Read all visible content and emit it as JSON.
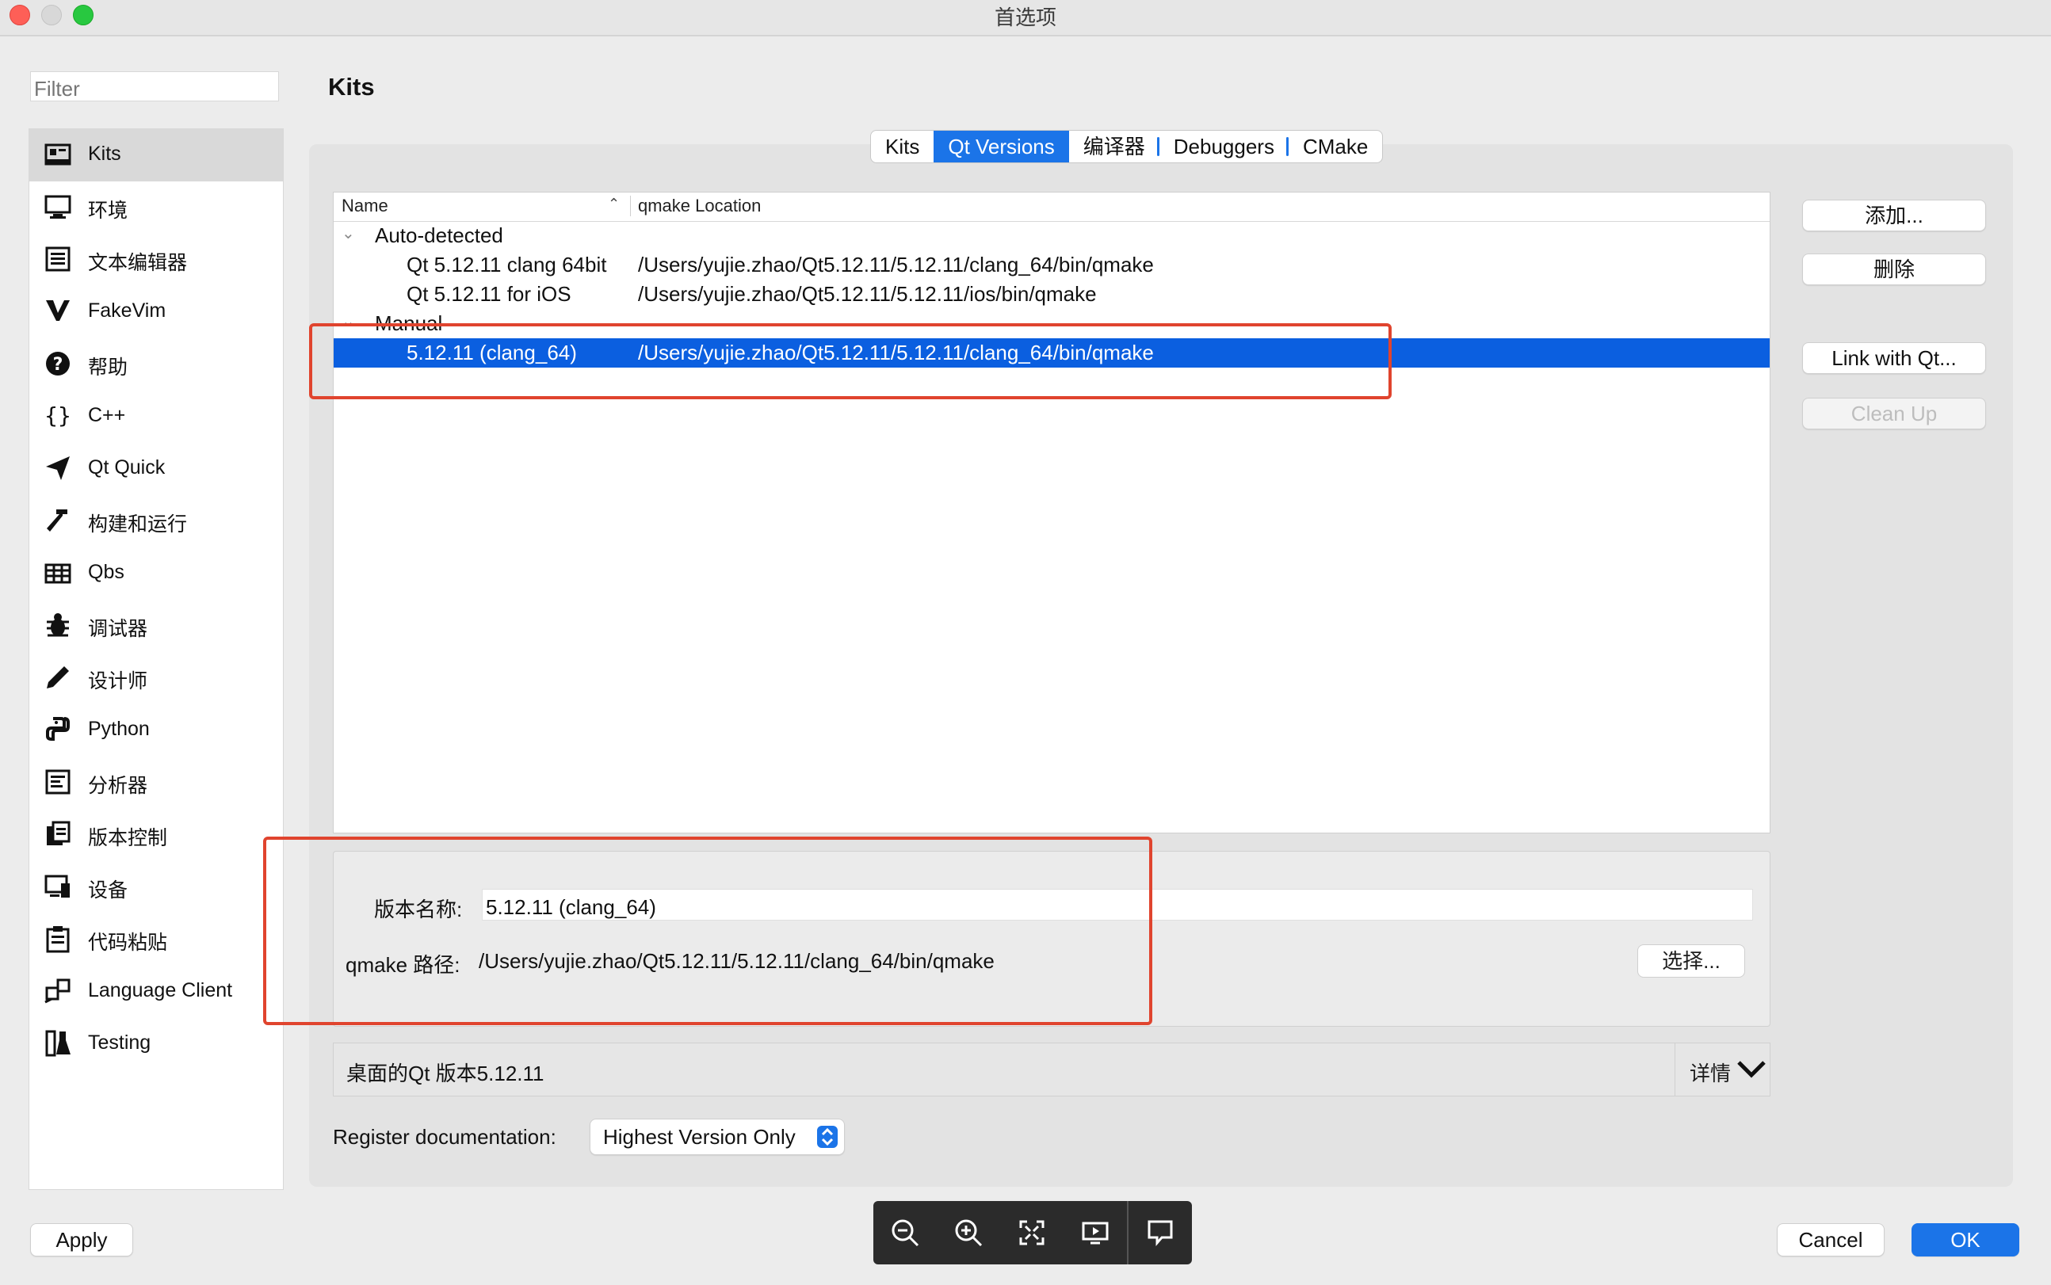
{
  "window": {
    "title": "首选项"
  },
  "sidebar": {
    "filter_placeholder": "Filter",
    "items": [
      {
        "label": "Kits",
        "icon": "kits-icon",
        "selected": true
      },
      {
        "label": "环境",
        "icon": "environment-icon"
      },
      {
        "label": "文本编辑器",
        "icon": "text-editor-icon"
      },
      {
        "label": "FakeVim",
        "icon": "fakevim-icon"
      },
      {
        "label": "帮助",
        "icon": "help-icon"
      },
      {
        "label": "C++",
        "icon": "braces-icon"
      },
      {
        "label": "Qt Quick",
        "icon": "qt-quick-icon"
      },
      {
        "label": "构建和运行",
        "icon": "hammer-icon"
      },
      {
        "label": "Qbs",
        "icon": "qbs-icon"
      },
      {
        "label": "调试器",
        "icon": "bug-icon"
      },
      {
        "label": "设计师",
        "icon": "pencil-icon"
      },
      {
        "label": "Python",
        "icon": "python-icon"
      },
      {
        "label": "分析器",
        "icon": "analyzer-icon"
      },
      {
        "label": "版本控制",
        "icon": "version-control-icon"
      },
      {
        "label": "设备",
        "icon": "device-icon"
      },
      {
        "label": "代码粘贴",
        "icon": "clipboard-icon"
      },
      {
        "label": "Language Client",
        "icon": "language-client-icon"
      },
      {
        "label": "Testing",
        "icon": "testing-icon"
      }
    ]
  },
  "main": {
    "title": "Kits",
    "tabs": [
      {
        "label": "Kits"
      },
      {
        "label": "Qt Versions",
        "selected": true
      },
      {
        "label": "编译器"
      },
      {
        "label": "Debuggers"
      },
      {
        "label": "CMake"
      }
    ],
    "tree": {
      "columns": [
        "Name",
        "qmake Location"
      ],
      "groups": [
        {
          "label": "Auto-detected",
          "rows": [
            {
              "name": "Qt 5.12.11 clang 64bit",
              "location": "/Users/yujie.zhao/Qt5.12.11/5.12.11/clang_64/bin/qmake"
            },
            {
              "name": "Qt 5.12.11 for iOS",
              "location": "/Users/yujie.zhao/Qt5.12.11/5.12.11/ios/bin/qmake"
            }
          ]
        },
        {
          "label": "Manual",
          "rows": [
            {
              "name": "5.12.11 (clang_64)",
              "location": "/Users/yujie.zhao/Qt5.12.11/5.12.11/clang_64/bin/qmake",
              "selected": true
            }
          ]
        }
      ]
    },
    "right_buttons": {
      "add": "添加...",
      "remove": "删除",
      "link": "Link with Qt...",
      "cleanup": "Clean Up"
    },
    "detail": {
      "version_name_label": "版本名称:",
      "version_name_value": "5.12.11 (clang_64)",
      "qmake_path_label": "qmake 路径:",
      "qmake_path_value": "/Users/yujie.zhao/Qt5.12.11/5.12.11/clang_64/bin/qmake",
      "choose_button": "选择..."
    },
    "info": {
      "text": "桌面的Qt 版本5.12.11",
      "details_button": "详情"
    },
    "register_doc": {
      "label": "Register documentation:",
      "value": "Highest Version Only"
    }
  },
  "footer": {
    "apply": "Apply",
    "cancel": "Cancel",
    "ok": "OK"
  },
  "toolbar": {
    "icons": [
      "zoom-out-icon",
      "zoom-in-icon",
      "fit-screen-icon",
      "present-icon",
      "comment-icon"
    ]
  },
  "colors": {
    "accent": "#1b74e8",
    "selection": "#0b5fe0",
    "annotation": "#e0442e"
  }
}
